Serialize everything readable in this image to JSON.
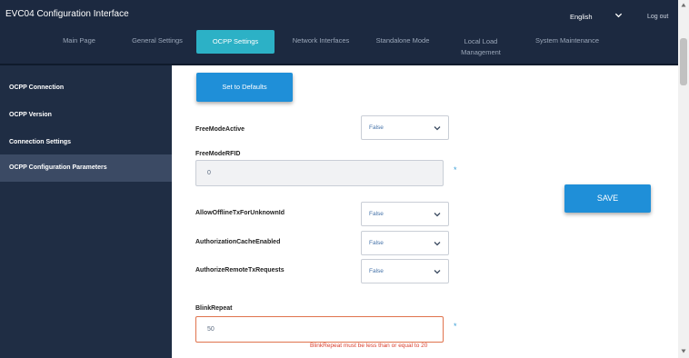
{
  "header": {
    "title": "EVC04 Configuration Interface",
    "language": "English",
    "logout_label": "Log out",
    "tabs": [
      {
        "label": "Main Page"
      },
      {
        "label": "General Settings"
      },
      {
        "label": "OCPP Settings"
      },
      {
        "label": "Network Interfaces"
      },
      {
        "label": "Standalone Mode"
      },
      {
        "label": "Local Load Management"
      },
      {
        "label": "System Maintenance"
      }
    ],
    "active_tab": "OCPP Settings"
  },
  "sidebar": {
    "items": [
      {
        "label": "OCPP Connection"
      },
      {
        "label": "OCPP Version"
      },
      {
        "label": "Connection Settings"
      },
      {
        "label": "OCPP Configuration Parameters"
      }
    ],
    "active_item": "OCPP Configuration Parameters"
  },
  "main": {
    "defaults_button": "Set to Defaults",
    "save_button": "SAVE",
    "required_marker": "*",
    "fields": {
      "free_mode_active": {
        "label": "FreeModeActive",
        "value": "False"
      },
      "free_mode_rfid": {
        "label": "FreeModeRFID",
        "value": "0"
      },
      "allow_offline": {
        "label": "AllowOfflineTxForUnknownId",
        "value": "False"
      },
      "auth_cache": {
        "label": "AuthorizationCacheEnabled",
        "value": "False"
      },
      "authorize_remote": {
        "label": "AuthorizeRemoteTxRequests",
        "value": "False"
      },
      "blink_repeat": {
        "label": "BlinkRepeat",
        "value": "50",
        "error": "BlinkRepeat must be less than or equal to 20"
      }
    }
  },
  "colors": {
    "header_bg": "#1c2940",
    "sidebar_bg": "#1f2d44",
    "accent_tab": "#2cb1c6",
    "button_blue": "#1f8fd8",
    "error_red": "#d93c2b"
  }
}
